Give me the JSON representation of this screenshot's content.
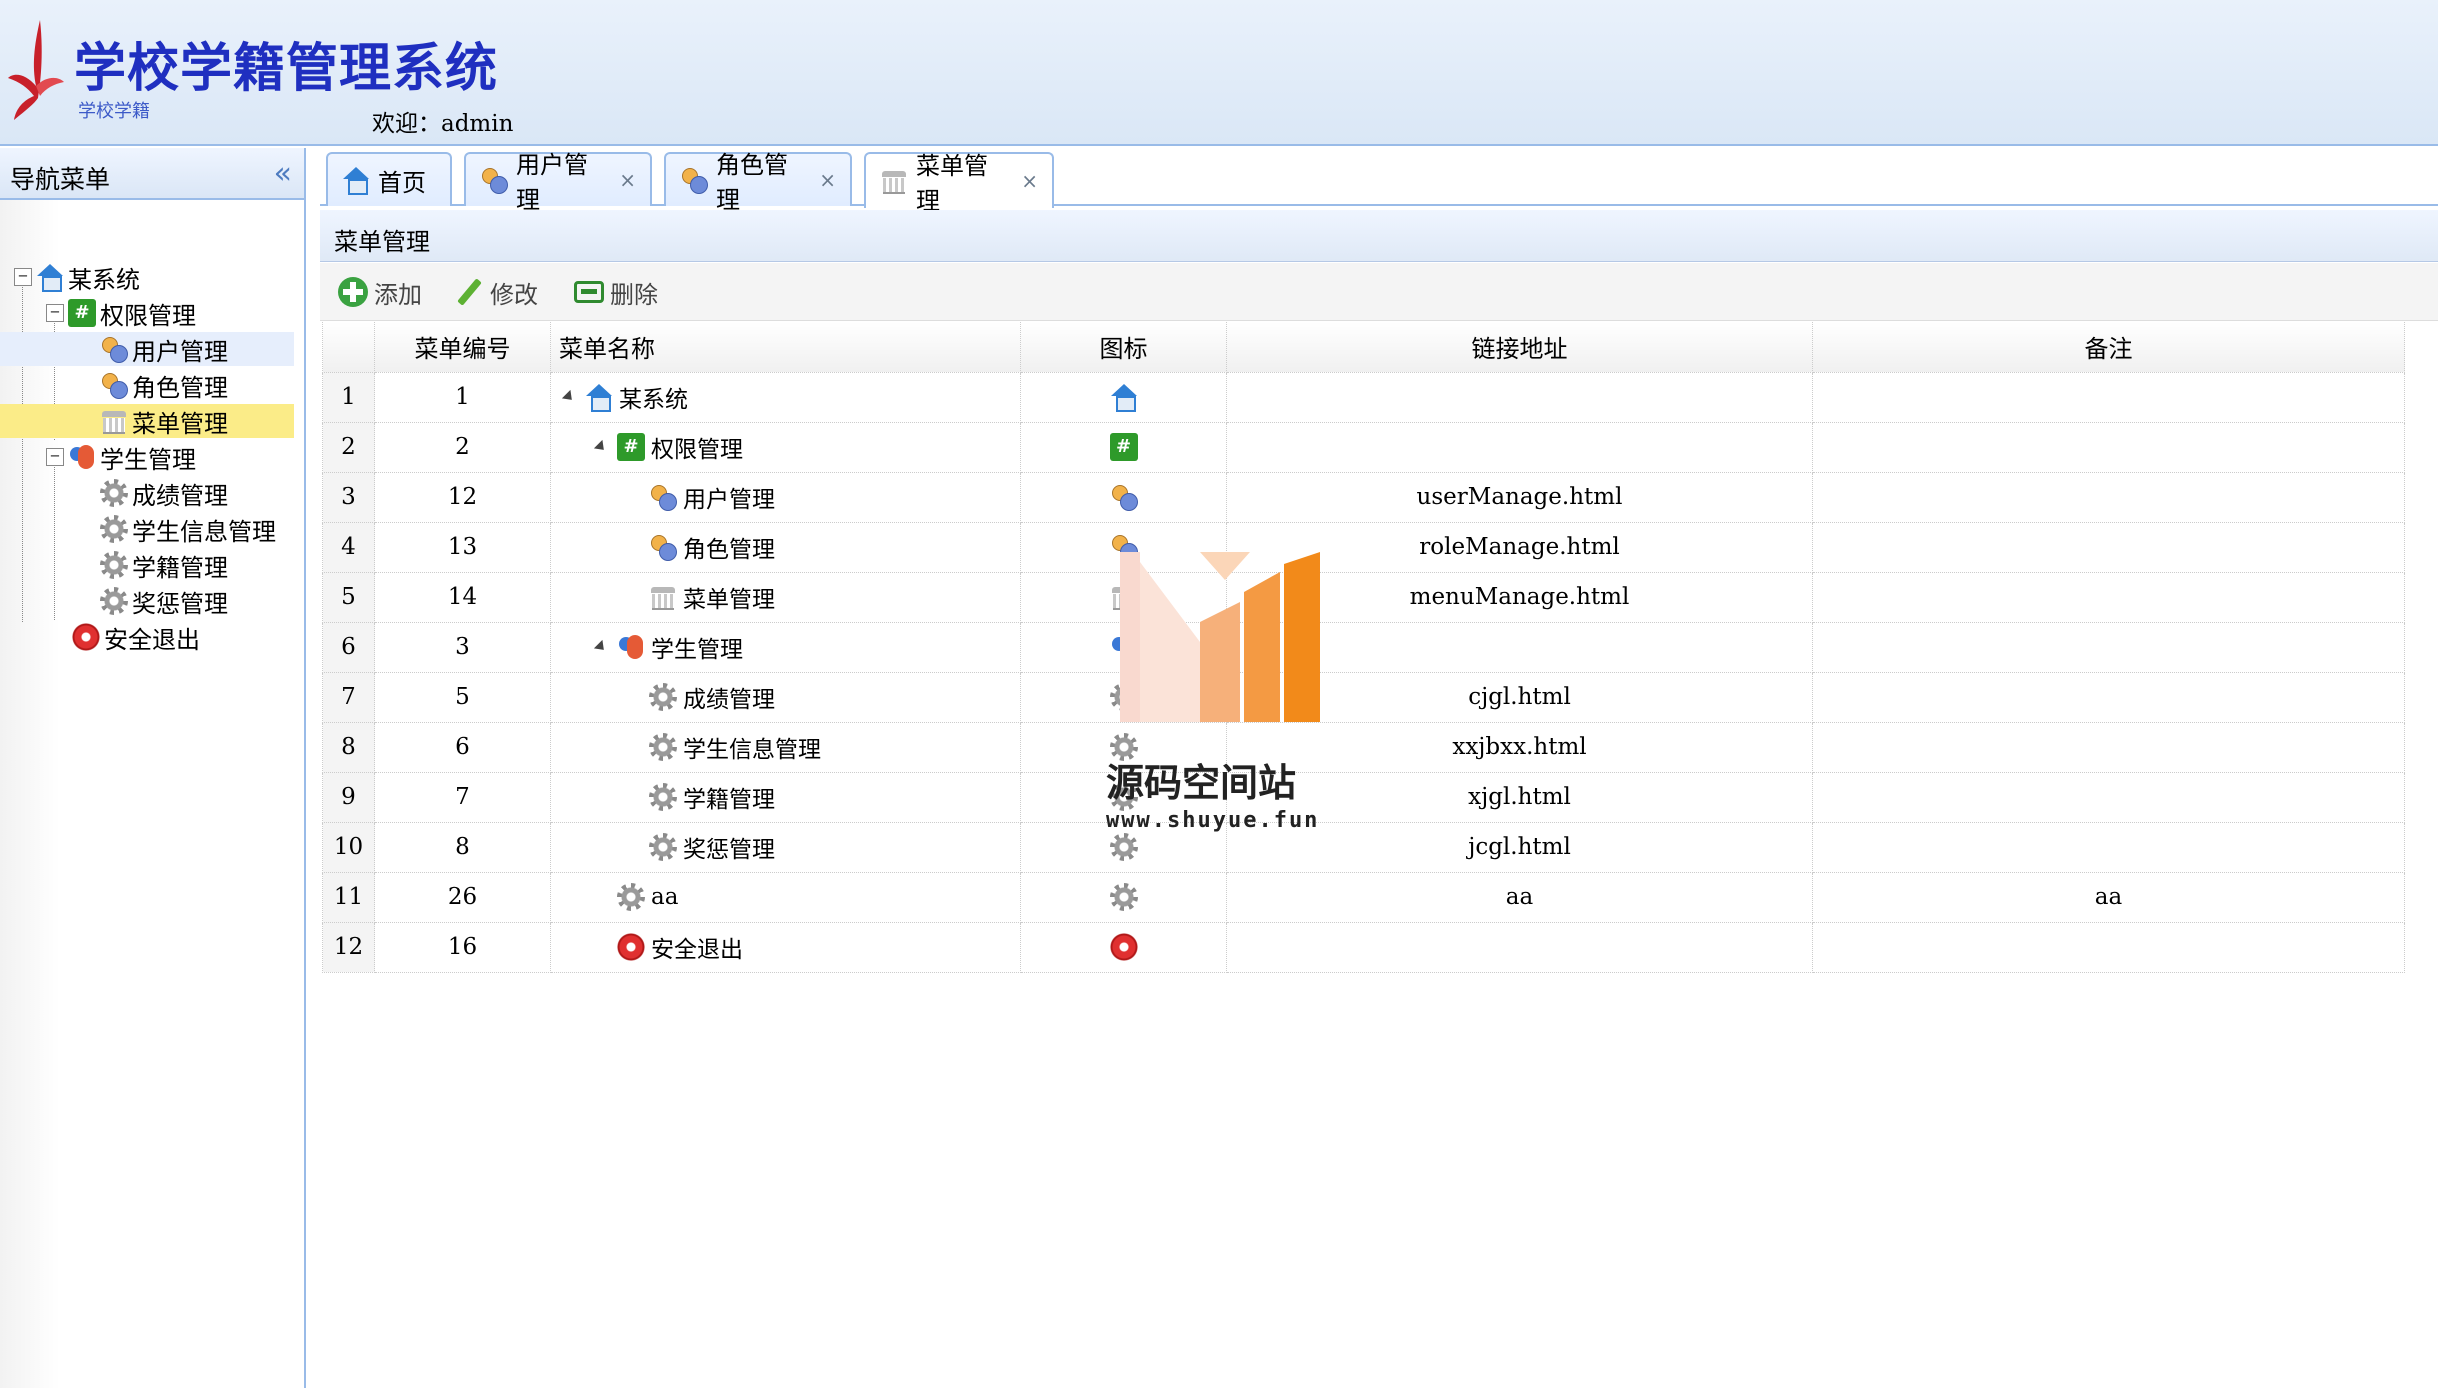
{
  "header": {
    "logo_title": "学校学籍管理系统",
    "logo_subtitle": "学校学籍",
    "welcome": "欢迎：admin"
  },
  "sidebar": {
    "title": "导航菜单",
    "tree": [
      {
        "label": "某系统",
        "icon": "home-icon"
      },
      {
        "label": "权限管理",
        "icon": "hash-icon"
      },
      {
        "label": "用户管理",
        "icon": "users-icon"
      },
      {
        "label": "角色管理",
        "icon": "users-icon"
      },
      {
        "label": "菜单管理",
        "icon": "menu-icon"
      },
      {
        "label": "学生管理",
        "icon": "student-icon"
      },
      {
        "label": "成绩管理",
        "icon": "gear-icon"
      },
      {
        "label": "学生信息管理",
        "icon": "gear-icon"
      },
      {
        "label": "学籍管理",
        "icon": "gear-icon"
      },
      {
        "label": "奖惩管理",
        "icon": "gear-icon"
      },
      {
        "label": "安全退出",
        "icon": "exit-icon"
      }
    ]
  },
  "tabs": [
    {
      "label": "首页",
      "icon": "home-icon",
      "closable": false
    },
    {
      "label": "用户管理",
      "icon": "users-icon",
      "closable": true
    },
    {
      "label": "角色管理",
      "icon": "users-icon",
      "closable": true
    },
    {
      "label": "菜单管理",
      "icon": "menu-icon",
      "closable": true,
      "active": true
    }
  ],
  "tab_close_glyph": "×",
  "content": {
    "title": "菜单管理",
    "toolbar": {
      "add_label": "添加",
      "edit_label": "修改",
      "delete_label": "删除"
    },
    "columns": [
      "",
      "菜单编号",
      "菜单名称",
      "图标",
      "链接地址",
      "备注"
    ],
    "rows": [
      {
        "rn": "1",
        "id": "1",
        "name": "某系统",
        "icon": "home-icon",
        "url": "",
        "remark": ""
      },
      {
        "rn": "2",
        "id": "2",
        "name": "权限管理",
        "icon": "hash-icon",
        "url": "",
        "remark": ""
      },
      {
        "rn": "3",
        "id": "12",
        "name": "用户管理",
        "icon": "users-icon",
        "url": "userManage.html",
        "remark": ""
      },
      {
        "rn": "4",
        "id": "13",
        "name": "角色管理",
        "icon": "users-icon",
        "url": "roleManage.html",
        "remark": ""
      },
      {
        "rn": "5",
        "id": "14",
        "name": "菜单管理",
        "icon": "menu-icon",
        "url": "menuManage.html",
        "remark": ""
      },
      {
        "rn": "6",
        "id": "3",
        "name": "学生管理",
        "icon": "student-icon",
        "url": "",
        "remark": ""
      },
      {
        "rn": "7",
        "id": "5",
        "name": "成绩管理",
        "icon": "gear-icon",
        "url": "cjgl.html",
        "remark": ""
      },
      {
        "rn": "8",
        "id": "6",
        "name": "学生信息管理",
        "icon": "gear-icon",
        "url": "xxjbxx.html",
        "remark": ""
      },
      {
        "rn": "9",
        "id": "7",
        "name": "学籍管理",
        "icon": "gear-icon",
        "url": "xjgl.html",
        "remark": ""
      },
      {
        "rn": "10",
        "id": "8",
        "name": "奖惩管理",
        "icon": "gear-icon",
        "url": "jcgl.html",
        "remark": ""
      },
      {
        "rn": "11",
        "id": "26",
        "name": "aa",
        "icon": "gear-icon",
        "url": "aa",
        "remark": "aa"
      },
      {
        "rn": "12",
        "id": "16",
        "name": "安全退出",
        "icon": "exit-icon",
        "url": "",
        "remark": ""
      }
    ]
  },
  "watermark": {
    "text": "源码空间站",
    "url": "www.shuyue.fun"
  },
  "colors": {
    "accent": "#99bbe8",
    "selected": "#fbec88",
    "logo_text": "#1f2fc0",
    "watermark_orange": "#f28a1a"
  }
}
